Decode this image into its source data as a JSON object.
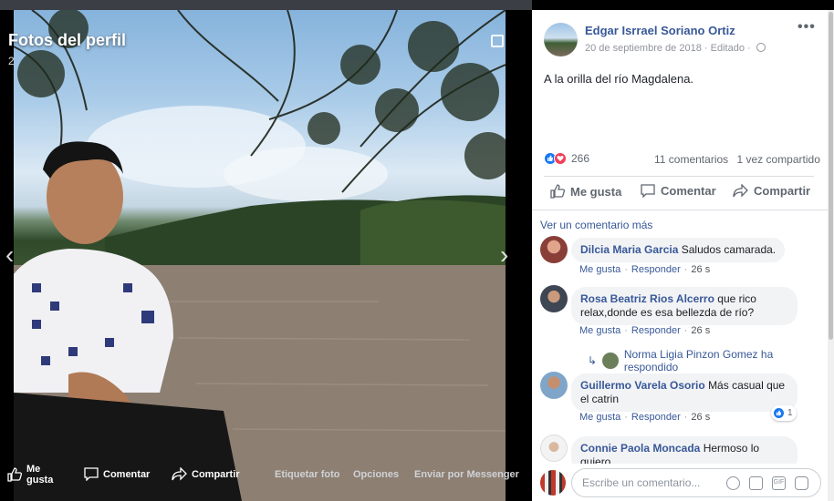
{
  "viewer": {
    "title": "Fotos del perfil",
    "count": "2",
    "actions": {
      "like": "Me gusta",
      "comment": "Comentar",
      "share": "Compartir",
      "tag": "Etiquetar foto",
      "options": "Opciones",
      "send": "Enviar por Messenger"
    }
  },
  "post": {
    "author": "Edgar Isrrael Soriano Ortiz",
    "date": "20 de septiembre de 2018",
    "edited": "Editado",
    "text": "A la orilla del río Magdalena.",
    "reaction_count": "266",
    "comments_count": "11 comentarios",
    "shares_count": "1 vez compartido",
    "buttons": {
      "like": "Me gusta",
      "comment": "Comentar",
      "share": "Compartir"
    }
  },
  "comments": {
    "view_more": "Ver un comentario más",
    "items": [
      {
        "author": "Dilcia Maria Garcia",
        "text": "Saludos camarada.",
        "like": "Me gusta",
        "reply": "Responder",
        "time": "26 s"
      },
      {
        "author": "Rosa Beatriz Rios Alcerro",
        "text": "que rico relax,donde es esa bellezda de río?",
        "text_l1": "que rico",
        "text_l2": "relax,donde es esa bellezda de río?",
        "like": "Me gusta",
        "reply": "Responder",
        "time": "26 s"
      },
      {
        "author": "Guillermo Varela Osorio",
        "text": "Más casual que el catrin",
        "text_l1": "Más casual que",
        "text_l2": "el catrin",
        "like": "Me gusta",
        "reply": "Responder",
        "time": "26 s",
        "likes": "1"
      },
      {
        "author": "Connie Paola Moncada",
        "text": "Hermoso lo quiero mucho",
        "text_l1": "Hermoso lo quiero",
        "text_l2": "mucho"
      }
    ],
    "reply_note": "Norma Ligia Pinzon Gomez ha respondido"
  },
  "composer": {
    "placeholder": "Escribe un comentario...",
    "gif_label": "GIF"
  },
  "icons": [
    "thumbs-up-icon",
    "comment-icon",
    "share-icon",
    "globe-icon",
    "more-icon",
    "expand-icon",
    "chevron-left-icon",
    "chevron-right-icon",
    "emoji-icon",
    "camera-icon",
    "gif-icon",
    "sticker-icon"
  ],
  "colors": {
    "link": "#385898",
    "like_blue": "#1877f2",
    "love_red": "#f33e58",
    "bubble_bg": "#f2f3f5",
    "viewer_bg": "#000000"
  }
}
